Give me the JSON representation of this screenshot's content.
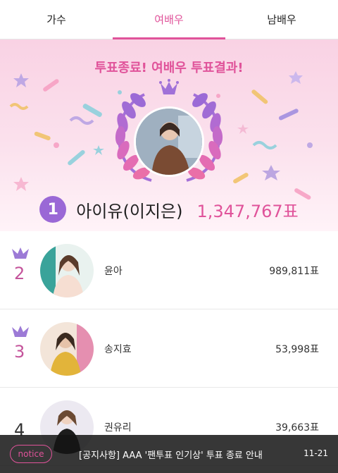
{
  "tabs": [
    {
      "label": "가수",
      "active": false
    },
    {
      "label": "여배우",
      "active": true
    },
    {
      "label": "남배우",
      "active": false
    }
  ],
  "hero": {
    "title": "투표종료! 여배우 투표결과!",
    "winner": {
      "rank": "1",
      "name": "아이유(이지은)",
      "votes": "1,347,767표"
    }
  },
  "ranking": [
    {
      "rank": "2",
      "name": "윤아",
      "votes": "989,811표",
      "crown": true
    },
    {
      "rank": "3",
      "name": "송지효",
      "votes": "53,998표",
      "crown": true
    },
    {
      "rank": "4",
      "name": "권유리",
      "votes": "39,663표",
      "crown": false
    }
  ],
  "notice": {
    "label": "notice",
    "text": "[공지사항] AAA '팬투표 인기상' 투표 종료 안내",
    "date": "11-21"
  },
  "colors": {
    "accent": "#e0539a",
    "rank_badge": "#9a68d6"
  }
}
